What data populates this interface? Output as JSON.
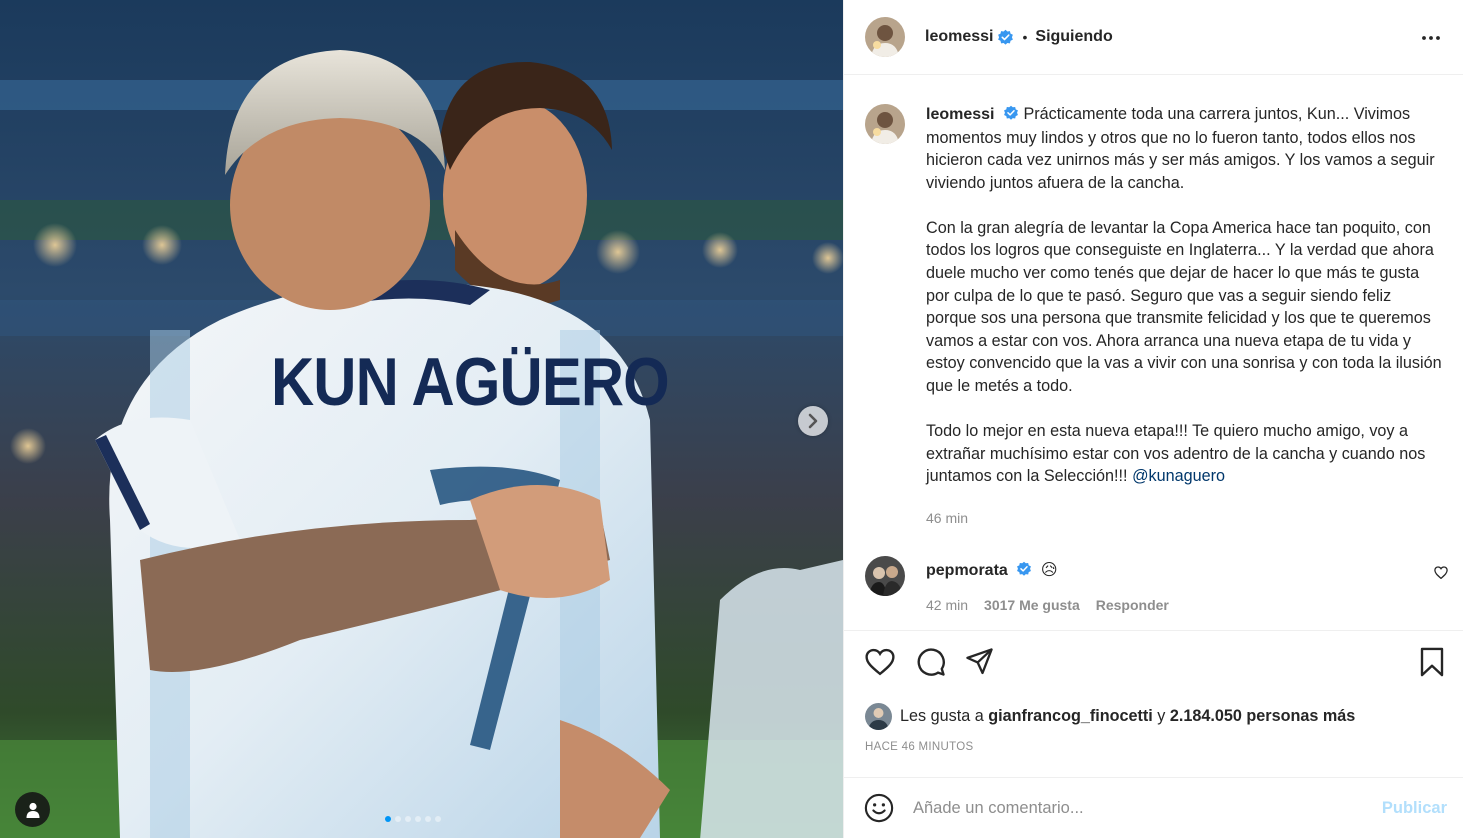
{
  "post": {
    "author": "leomessi",
    "follow_status": "Siguiendo",
    "separator": "•",
    "caption_paragraphs": [
      "Prácticamente toda una carrera juntos, Kun... Vivimos momentos muy lindos y otros que no lo fueron tanto, todos ellos nos hicieron cada vez unirnos más y ser más amigos. Y los vamos a seguir viviendo juntos afuera de la cancha.",
      "Con la gran alegría de levantar la Copa America hace tan poquito, con todos los logros que conseguiste en Inglaterra... Y la verdad que ahora duele mucho ver como tenés que dejar de hacer lo que más te gusta por culpa de lo que te pasó. Seguro que vas a seguir siendo feliz porque sos una persona que transmite felicidad y los que te queremos vamos a estar con vos. Ahora arranca una nueva etapa de tu vida y estoy convencido que la vas a vivir con una sonrisa y con toda la ilusión que le metés a todo.",
      "Todo lo mejor en esta nueva etapa!!! Te quiero mucho amigo, voy a extrañar muchísimo estar con vos adentro de la cancha y cuando nos juntamos con la Selección!!!"
    ],
    "caption_mention": "@kunaguero",
    "caption_time": "46 min",
    "jersey_text": "KUN AGÜERO",
    "carousel_slides": 6,
    "carousel_active": 0
  },
  "comment": {
    "author": "pepmorata",
    "emoji": "😥",
    "time": "42 min",
    "likes": "3017 Me gusta",
    "reply": "Responder"
  },
  "likes": {
    "prefix": "Les gusta a ",
    "user": "gianfrancog_finocetti",
    "connector": " y ",
    "count": "2.184.050 personas más"
  },
  "timestamp": "HACE 46 MINUTOS",
  "composer": {
    "placeholder": "Añade un comentario...",
    "post_label": "Publicar"
  },
  "icons": {
    "verified": "verified-badge-icon",
    "more": "more-options-icon",
    "like": "heart-icon",
    "comment": "comment-icon",
    "share": "paper-plane-icon",
    "save": "bookmark-icon",
    "emoji": "emoji-icon",
    "next": "chevron-right-icon",
    "tags": "user-tag-icon"
  },
  "colors": {
    "verified": "#3897f0",
    "link": "#00376b",
    "muted": "#8e8e8e",
    "post_disabled": "#b2dffc",
    "carousel_active": "#0095f6"
  }
}
